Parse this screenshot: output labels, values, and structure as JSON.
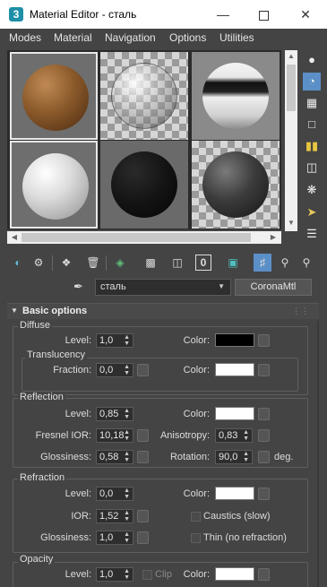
{
  "window": {
    "app_icon": "3",
    "title": "Material Editor - сталь"
  },
  "menubar": [
    "Modes",
    "Material",
    "Navigation",
    "Options",
    "Utilities"
  ],
  "slots": {
    "items": [
      {
        "material": "wood",
        "selected": true
      },
      {
        "material": "glass",
        "selected": false
      },
      {
        "material": "chrome",
        "selected": false
      },
      {
        "material": "white",
        "selected": true
      },
      {
        "material": "black",
        "selected": false
      },
      {
        "material": "steel",
        "selected": false
      }
    ]
  },
  "right_toolbar": [
    "sample-type-icon",
    "backlight-icon",
    "background-icon",
    "uv-tiling-icon",
    "video-color-check-icon",
    "make-preview-icon",
    "options-icon",
    "select-by-material-icon",
    "material-navigator-icon"
  ],
  "toolbar": [
    "get-material-icon",
    "put-to-scene-icon",
    "assign-to-selection-icon",
    "reset-map-icon",
    "copy-material-icon",
    "make-unique-icon",
    "put-to-library-icon",
    "material-id-channel-icon",
    "show-map-in-viewport-icon",
    "show-end-result-icon",
    "go-to-parent-icon",
    "go-forward-to-sibling-icon"
  ],
  "material_id_channel": "0",
  "name_row": {
    "material_name": "сталь",
    "material_type": "CoronaMtl"
  },
  "rollout": {
    "title": "Basic options",
    "diffuse": {
      "title": "Diffuse",
      "level_label": "Level:",
      "level_value": "1,0",
      "color_label": "Color:",
      "color": "#000000",
      "translucency": {
        "title": "Translucency",
        "fraction_label": "Fraction:",
        "fraction_value": "0,0",
        "color_label": "Color:",
        "color": "#ffffff"
      }
    },
    "reflection": {
      "title": "Reflection",
      "level_label": "Level:",
      "level_value": "0,85",
      "color_label": "Color:",
      "color": "#ffffff",
      "fresnel_label": "Fresnel IOR:",
      "fresnel_value": "10,18",
      "anisotropy_label": "Anisotropy:",
      "anisotropy_value": "0,83",
      "glossiness_label": "Glossiness:",
      "glossiness_value": "0,58",
      "rotation_label": "Rotation:",
      "rotation_value": "90,0",
      "rotation_unit": "deg."
    },
    "refraction": {
      "title": "Refraction",
      "level_label": "Level:",
      "level_value": "0,0",
      "color_label": "Color:",
      "color": "#ffffff",
      "ior_label": "IOR:",
      "ior_value": "1,52",
      "caustics_label": "Caustics (slow)",
      "glossiness_label": "Glossiness:",
      "glossiness_value": "1,0",
      "thin_label": "Thin (no refraction)"
    },
    "opacity": {
      "title": "Opacity",
      "level_label": "Level:",
      "level_value": "1,0",
      "clip_label": "Clip",
      "color_label": "Color:",
      "color": "#ffffff"
    }
  }
}
